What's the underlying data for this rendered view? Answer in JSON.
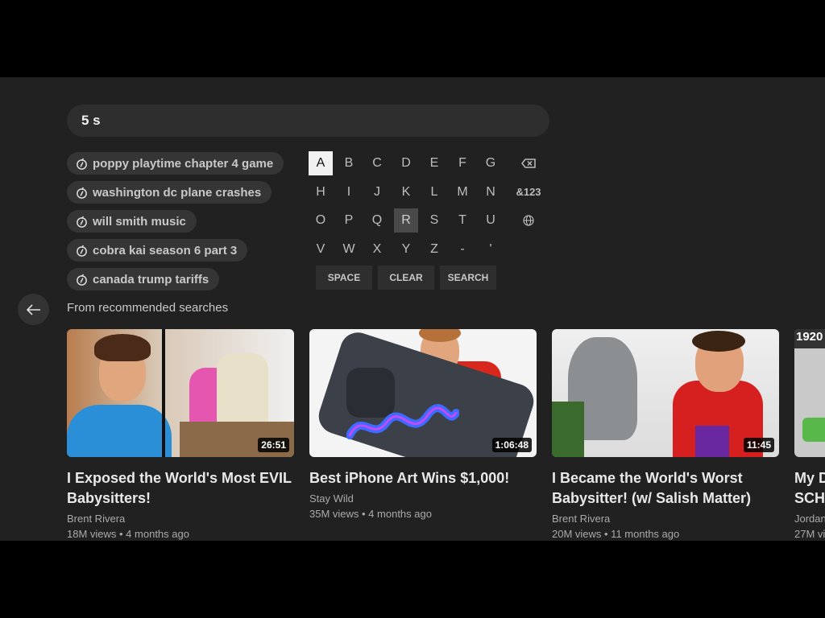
{
  "search": {
    "query": "5 s"
  },
  "suggestions": [
    {
      "label": "poppy playtime chapter 4 game"
    },
    {
      "label": "washington dc plane crashes"
    },
    {
      "label": "will smith music"
    },
    {
      "label": "cobra kai season 6 part 3"
    },
    {
      "label": "canada trump tariffs"
    }
  ],
  "keyboard": {
    "rows": [
      [
        "A",
        "B",
        "C",
        "D",
        "E",
        "F",
        "G"
      ],
      [
        "H",
        "I",
        "J",
        "K",
        "L",
        "M",
        "N"
      ],
      [
        "O",
        "P",
        "Q",
        "R",
        "S",
        "T",
        "U"
      ],
      [
        "V",
        "W",
        "X",
        "Y",
        "Z",
        "-",
        "'"
      ]
    ],
    "active_key": "A",
    "hover_key": "R",
    "symbols_label": "&123",
    "space_label": "SPACE",
    "clear_label": "CLEAR",
    "search_label": "SEARCH"
  },
  "section": {
    "title": "From recommended searches"
  },
  "videos": [
    {
      "title_line1": "I Exposed the World's Most EVIL",
      "title_line2": "Babysitters!",
      "channel": "Brent Rivera",
      "meta": "18M views • 4 months ago",
      "duration": "26:51"
    },
    {
      "title_line1": "Best iPhone Art Wins $1,000!",
      "title_line2": "",
      "channel": "Stay Wild",
      "meta": "35M views • 4 months ago",
      "duration": "1:06:48"
    },
    {
      "title_line1": "I Became the World's Worst",
      "title_line2": "Babysitter! (w/ Salish Matter)",
      "channel": "Brent Rivera",
      "meta": "20M views • 11 months ago",
      "duration": "11:45"
    },
    {
      "title_line1": "My D",
      "title_line2": "SCH",
      "channel": "Jordan",
      "meta": "27M vi",
      "duration": "",
      "thumb_text": "1920"
    }
  ],
  "colors": {
    "background": "#212121",
    "chip": "#353535",
    "active_key": "#f1f1f1"
  }
}
